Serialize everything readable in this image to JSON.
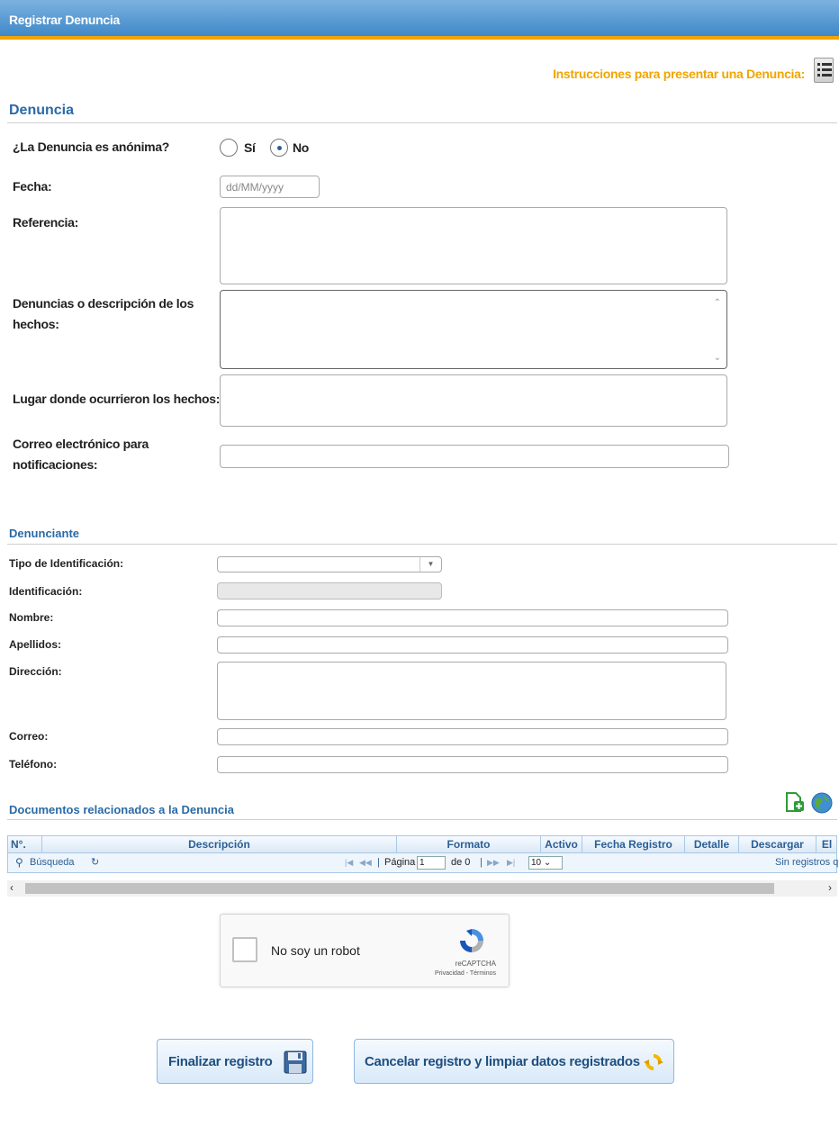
{
  "header": {
    "title": "Registrar Denuncia"
  },
  "instructions": {
    "link_label": "Instrucciones para presentar una Denuncia:"
  },
  "denuncia": {
    "section_title": "Denuncia",
    "anonymous_label": "¿La Denuncia es anónima?",
    "option_yes": "Sí",
    "option_no": "No",
    "selected": "No",
    "date_label": "Fecha:",
    "date_placeholder": "dd/MM/yyyy",
    "reference_label": "Referencia:",
    "description_label": "Denuncias o descripción de los hechos:",
    "place_label": "Lugar donde ocurrieron los hechos:",
    "email_label": "Correo electrónico para notificaciones:"
  },
  "denunciante": {
    "section_title": "Denunciante",
    "id_type_label": "Tipo de Identificación:",
    "id_label": "Identificación:",
    "name_label": "Nombre:",
    "surname_label": "Apellidos:",
    "address_label": "Dirección:",
    "email_label": "Correo:",
    "phone_label": "Teléfono:"
  },
  "documents": {
    "section_title": "Documentos relacionados a la Denuncia",
    "columns": [
      "N°.",
      "Descripción",
      "Formato",
      "Activo",
      "Fecha Registro",
      "Detalle",
      "Descargar",
      "El"
    ],
    "pager": {
      "search_label": "Búsqueda",
      "page_label": "Página",
      "page_value": "1",
      "page_total": "de 0",
      "page_size": "10",
      "empty_text": "Sin registros qu"
    }
  },
  "captcha": {
    "label": "No soy un robot",
    "brand": "reCAPTCHA",
    "links": "Privacidad - Términos"
  },
  "actions": {
    "finish_label": "Finalizar registro",
    "cancel_label": "Cancelar registro y limpiar datos registrados"
  },
  "colors": {
    "accent": "#f2a400",
    "section_title": "#2a6aa6",
    "header_top": "#7cb2e0",
    "header_bottom": "#3f88c8"
  }
}
